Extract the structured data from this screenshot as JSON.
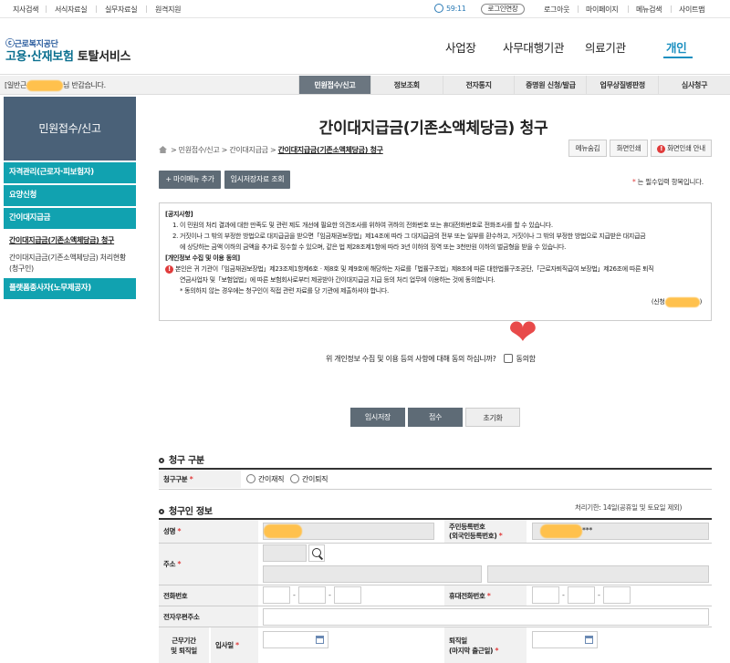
{
  "topbar": {
    "links": [
      "지사검색",
      "서식자료실",
      "실무자료실",
      "원격지원"
    ],
    "timer": "59:11",
    "extend_label": "로그인연장",
    "right_links": [
      "로그아웃",
      "마이페이지",
      "메뉴검색",
      "사이트맵"
    ]
  },
  "header": {
    "org": "근로복지공단",
    "service": "고용·산재보험",
    "service_suffix": "토탈서비스",
    "gnb": [
      "사업장",
      "사무대행기관",
      "의료기관",
      "개인"
    ]
  },
  "greeting": {
    "prefix": "[일반근",
    "suffix": "님 반갑습니다."
  },
  "tabs": [
    "민원접수/신고",
    "정보조회",
    "전자통지",
    "증명원 신청/발급",
    "업무상질병판정",
    "심사청구"
  ],
  "sidebar": {
    "title": "민원접수/신고",
    "items": [
      "자격관리(근로자·피보험자)",
      "요양신청",
      "간이대지급금"
    ],
    "sub_items": [
      "간이대지급금(기존소액체당금) 청구",
      "간이대지급금(기존소액체당금) 처리현황",
      "(청구인)"
    ],
    "extra_item": "플랫폼종사자(노무제공자)"
  },
  "page": {
    "title": "간이대지급금(기존소액체당금) 청구",
    "breadcrumb": [
      "민원접수/신고",
      "간이대지급금",
      "간이대지급금(기존소액체당금) 청구"
    ],
    "breadcrumb_sep": ">",
    "buttons": {
      "hide_menu": "메뉴숨김",
      "print": "화면인쇄",
      "print_guide": "화면인쇄 안내"
    },
    "add_menu": "+ 마이메뉴 추가",
    "temp_lookup": "임시저장자료 조회",
    "required_note_star": "*",
    "required_note": " 는 필수입력 항목입니다."
  },
  "notice": {
    "h1": "[공지사항]",
    "l1": "1. 이 민원의 처리 결과에 대한 만족도 및 관련 제도 개선에 필요한 의견조사를 위하여 귀하의 전화번호 또는 휴대전화번호로 전화조사를 할 수 있습니다.",
    "l2a": "2. 거짓이나 그 밖의 부정한 방법으로 대지급금을 받으면「임금채권보장법」제14조에 따라 그 대지급금의 전부 또는 일부를 환수하고, 거짓이나 그 밖의 부정한 방법으로 지급받은 대지급금",
    "l2b": "에 상당하는 금액 이하의 금액을 추가로 징수할 수 있으며, 같은 법 제28조제1항에 따라 3년 이하의 징역 또는 3천만원 이하의 벌금형을 받을 수 있습니다.",
    "h2": "[개인정보 수집 및 이용 동의]",
    "l3a": "본인은 귀 기관이「임금채권보장법」제23조제1항제6호ㆍ제8호 및 제9호에 해당하는 자료를「법률구조법」제8조에 따른 대한법률구조공단,「근로자퇴직급여 보장법」제26조에 따른 퇴직",
    "l3b": "연금사업자 및「보험업법」에 따른 보험회사로부터 제공받아 간이대지급금 지급 등의 처리 업무에 이용하는 것에 동의합니다.",
    "l4": "* 동의하지 않는 경우에는 청구인이 직접 관련 자료를 당 기관에 제출하셔야 합니다.",
    "sign_prefix": "(신청",
    "sign_suffix": ")"
  },
  "consent": {
    "question": "위 개인정보 수집 및 이용 등의 사항에 대해 동의 하십니까?",
    "agree": "동의함"
  },
  "actions": {
    "temp_save": "임시저장",
    "submit": "접수",
    "reset": "초기화"
  },
  "claim_type": {
    "section": "청구 구분",
    "label": "청구구분",
    "star": "*",
    "options": [
      "간이재직",
      "간이퇴직"
    ]
  },
  "claimant": {
    "section": "청구인 정보",
    "deadline": "처리기한: 14일(공휴일 및 토요일 제외)",
    "name_label": "성명",
    "rrn_label_1": "주민등록번호",
    "rrn_label_2": "(외국인등록번호)",
    "rrn_mask": "***",
    "address_label": "주소",
    "phone_label": "전화번호",
    "mobile_label": "휴대전화번호",
    "email_label": "전자우편주소",
    "period_label_1": "근무기간",
    "period_label_2": "및 퇴직일",
    "join_label": "입사일",
    "retire_label_1": "퇴직일",
    "retire_label_2": "(마지막 출근일)",
    "dash": "-",
    "star": "*"
  },
  "colors": {
    "accent": "#11a2b0",
    "side_head": "#4a6178",
    "tab_on": "#6b7680",
    "heart": "#e84a4a"
  }
}
